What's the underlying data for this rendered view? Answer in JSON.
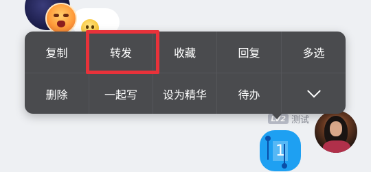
{
  "chat": {
    "sender_level": "LV2",
    "sender_name": "测试",
    "message_text": "1"
  },
  "context_menu": {
    "row1": [
      {
        "label": "复制"
      },
      {
        "label": "转发"
      },
      {
        "label": "收藏"
      },
      {
        "label": "回复"
      },
      {
        "label": "多选"
      }
    ],
    "row2": [
      {
        "label": "删除"
      },
      {
        "label": "一起写"
      },
      {
        "label": "设为精华"
      },
      {
        "label": "待办"
      }
    ],
    "more_icon": "chevron-down-icon"
  },
  "annotation": {
    "highlight_color": "#e8323a",
    "highlighted_item": "转发"
  },
  "colors": {
    "menu_bg": "#4a4b4e",
    "bubble": "#1ea0f2",
    "page_bg": "#eef0f3"
  }
}
